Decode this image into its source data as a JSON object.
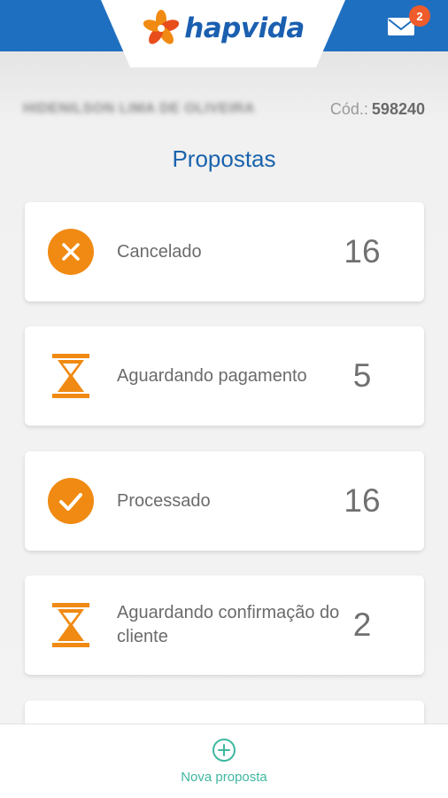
{
  "header": {
    "brand": "hapvida",
    "unread_count": "2"
  },
  "user": {
    "name": "HIDENILSON LIMA DE OLIVEIRA",
    "code_label": "Cód.:",
    "code_value": "598240"
  },
  "page": {
    "title": "Propostas"
  },
  "statuses": [
    {
      "label": "Cancelado",
      "count": "16",
      "icon": "cancel-icon"
    },
    {
      "label": "Aguardando pagamento",
      "count": "5",
      "icon": "hourglass-icon"
    },
    {
      "label": "Processado",
      "count": "16",
      "icon": "check-icon"
    },
    {
      "label": "Aguardando confirmação do cliente",
      "count": "2",
      "icon": "hourglass-icon"
    }
  ],
  "footer": {
    "new_label": "Nova proposta"
  },
  "colors": {
    "brand_blue": "#1f6fc0",
    "accent_orange": "#f08a12",
    "badge_red": "#ef5b2a",
    "action_teal": "#3fb7a0"
  }
}
